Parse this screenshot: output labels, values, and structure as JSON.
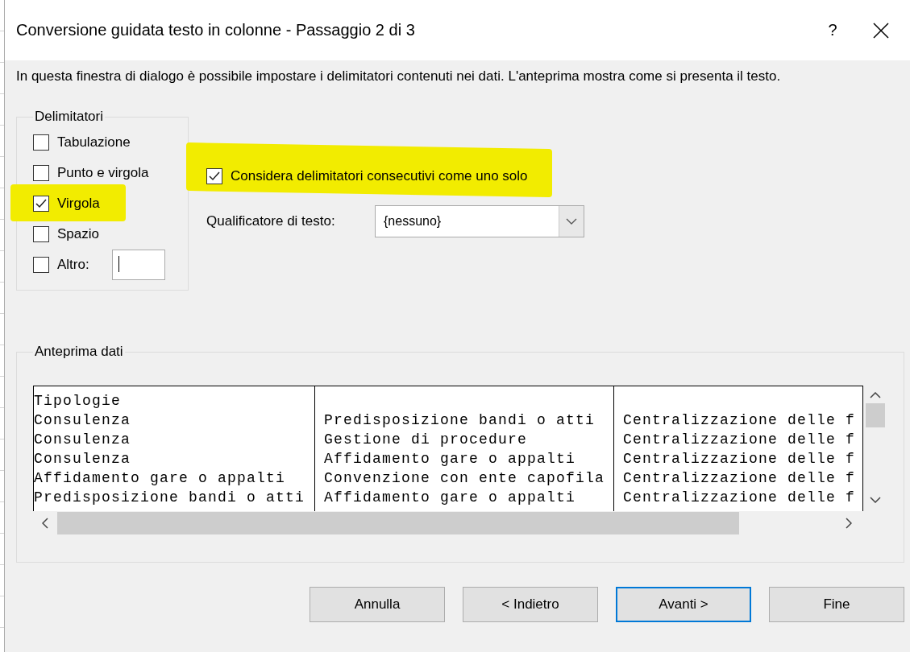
{
  "window": {
    "title": "Conversione guidata testo in colonne - Passaggio 2 di 3",
    "help": "?"
  },
  "description": "In questa finestra di dialogo è possibile impostare i delimitatori contenuti nei dati. L'anteprima mostra come si presenta il testo.",
  "delimiters": {
    "title": "Delimitatori",
    "items": [
      {
        "label": "Tabulazione",
        "kind": "plain",
        "checked": false,
        "highlighted": false
      },
      {
        "label": "Punto e virgola",
        "kind": "plain",
        "checked": false,
        "highlighted": false
      },
      {
        "label": "Virgola",
        "kind": "plain",
        "checked": true,
        "highlighted": true
      },
      {
        "label": "Spazio",
        "kind": "plain",
        "checked": false,
        "highlighted": false
      },
      {
        "label": "Altro:",
        "kind": "with_field",
        "checked": false,
        "highlighted": false
      }
    ]
  },
  "consecutive": {
    "label": "Considera delimitatori consecutivi come uno solo",
    "checked": true,
    "highlighted": true
  },
  "qualifier": {
    "label": "Qualificatore di testo:",
    "value": "{nessuno}"
  },
  "preview": {
    "title": "Anteprima dati",
    "rows": [
      {
        "column_1": "Tipologie"
      },
      {
        "column_1": "Consulenza",
        "column_2": "Predisposizione bandi o atti",
        "column_3": "Centralizzazione delle f"
      },
      {
        "column_1": "Consulenza",
        "column_2": "Gestione di procedure",
        "column_3": "Centralizzazione delle f"
      },
      {
        "column_1": "Consulenza",
        "column_2": "Affidamento gare o appalti",
        "column_3": "Centralizzazione delle f"
      },
      {
        "column_1": "Affidamento gare o appalti",
        "column_2": "Convenzione con ente capofila",
        "column_3": "Centralizzazione delle f"
      },
      {
        "column_1": "Predisposizione bandi o atti",
        "column_2": "Affidamento gare o appalti",
        "column_3": "Centralizzazione delle f"
      }
    ]
  },
  "buttons": [
    {
      "label": "Annulla",
      "default": false
    },
    {
      "label": "< Indietro",
      "default": false
    },
    {
      "label": "Avanti >",
      "default": true
    },
    {
      "label": "Fine",
      "default": false
    }
  ]
}
